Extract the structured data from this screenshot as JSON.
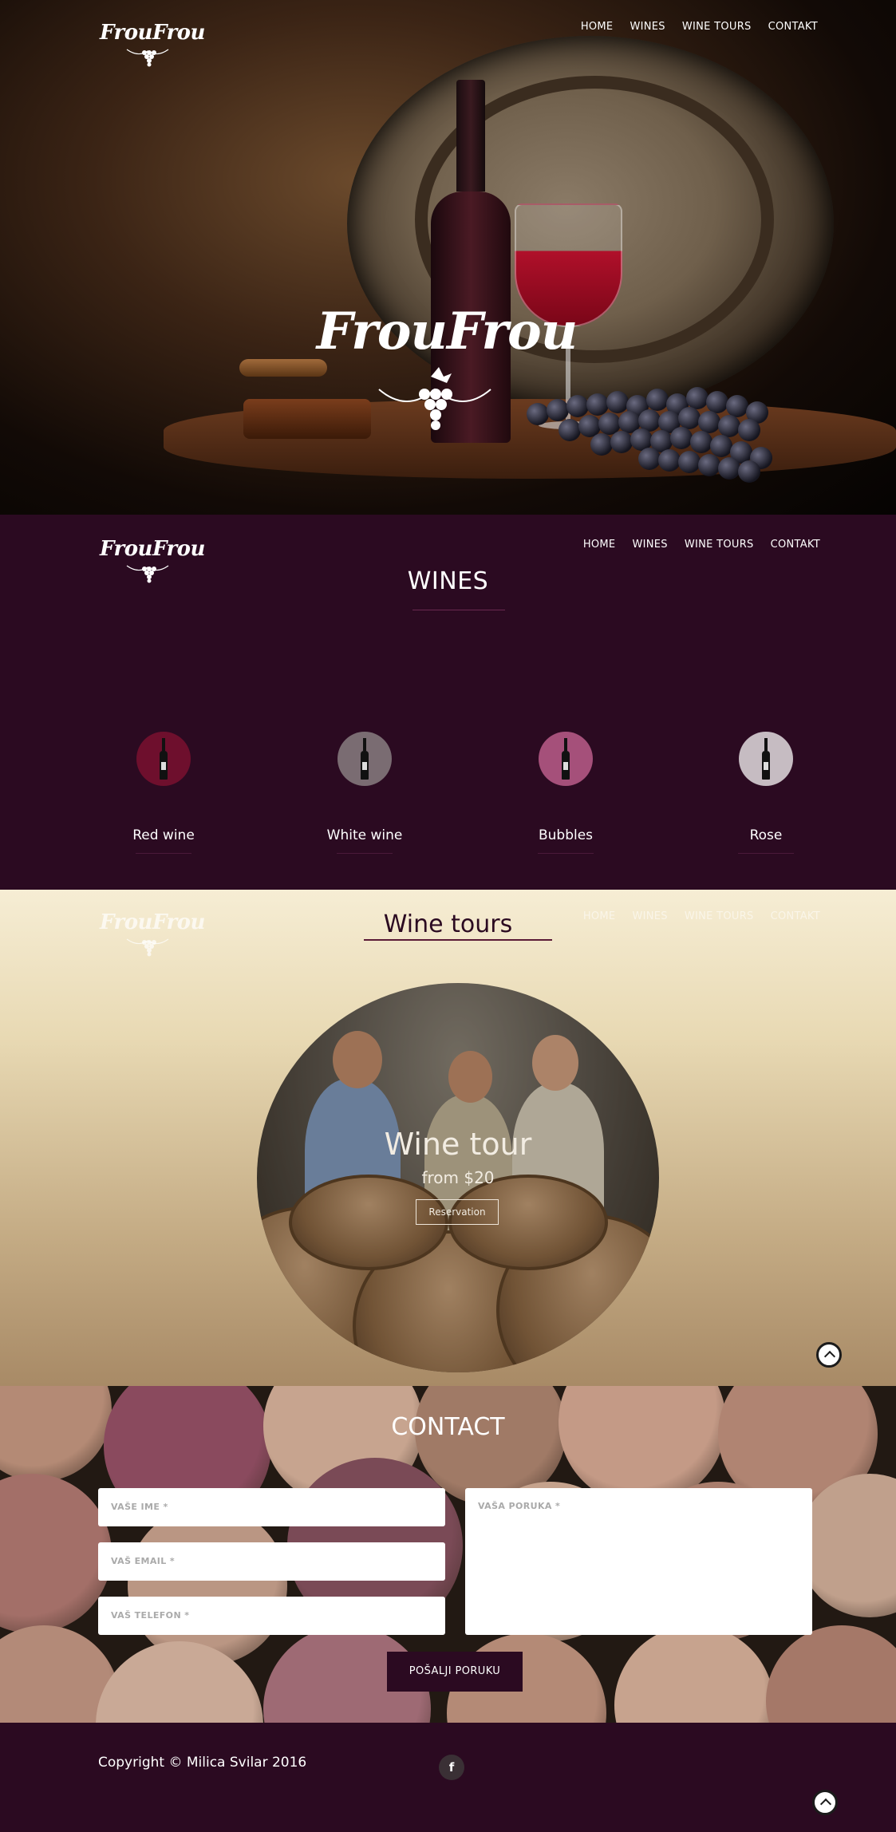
{
  "nav": {
    "items": [
      "HOME",
      "WINES",
      "WINE TOURS",
      "CONTAKT"
    ]
  },
  "logo": {
    "text": "FrouFrou"
  },
  "hero": {
    "title": "FrouFrou"
  },
  "wines": {
    "title": "WINES",
    "items": [
      {
        "label": "Red wine",
        "color": "#6e0f2d"
      },
      {
        "label": "White wine",
        "color": "#7a6c72"
      },
      {
        "label": "Bubbles",
        "color": "#a5507a"
      },
      {
        "label": "Rose",
        "color": "#c6bcc2"
      }
    ]
  },
  "tours": {
    "title": "Wine tours",
    "card_title": "Wine tour",
    "price": "from $20",
    "button": "Reservation"
  },
  "contact": {
    "title": "CONTACT",
    "name_placeholder": "VAŠE IME *",
    "email_placeholder": "VAŠ EMAIL *",
    "phone_placeholder": "VAŠ TELEFON *",
    "message_placeholder": "VAŠA PORUKA *",
    "submit": "POŠALJI PORUKU"
  },
  "footer": {
    "copyright": "Copyright © Milica Svilar 2016",
    "facebook": "f"
  },
  "colors": {
    "primary": "#2b0a21",
    "accent_rule": "#5a1a36"
  },
  "icons": [
    "grape-icon",
    "facebook-icon",
    "scroll-top-icon"
  ]
}
